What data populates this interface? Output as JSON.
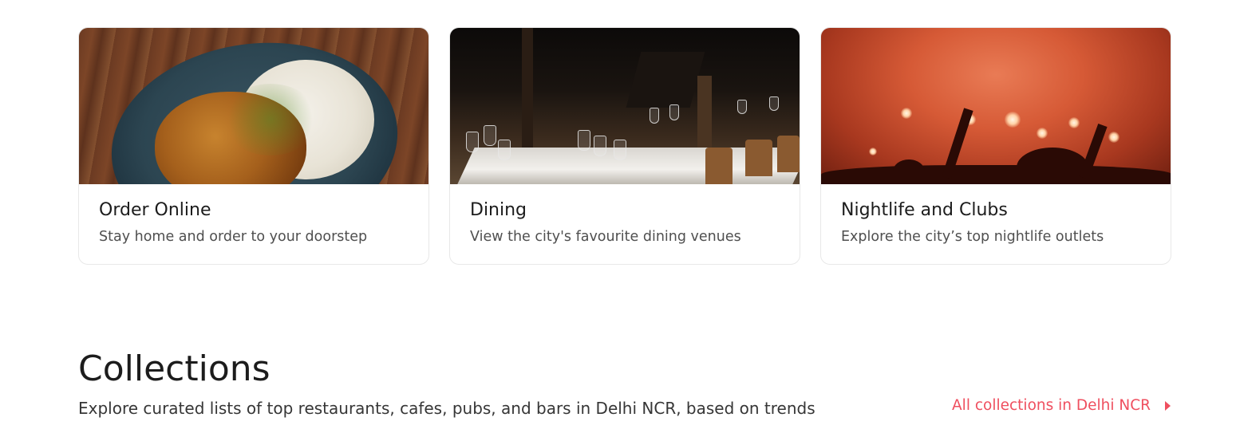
{
  "cards": [
    {
      "title": "Order Online",
      "subtitle": "Stay home and order to your doorstep",
      "image": "food-plate-image"
    },
    {
      "title": "Dining",
      "subtitle": "View the city's favourite dining venues",
      "image": "restaurant-dining-image"
    },
    {
      "title": "Nightlife and Clubs",
      "subtitle": "Explore the city’s top nightlife outlets",
      "image": "nightclub-crowd-image"
    }
  ],
  "collections": {
    "title": "Collections",
    "subtitle": "Explore curated lists of top restaurants, cafes, pubs, and bars in Delhi NCR, based on trends",
    "link_label": "All collections in Delhi NCR",
    "link_icon": "caret-right-icon"
  },
  "colors": {
    "accent": "#ef4f5f",
    "title": "#1c1c1c",
    "subtitle": "#4f4f4f",
    "border": "#e8e8e8"
  }
}
